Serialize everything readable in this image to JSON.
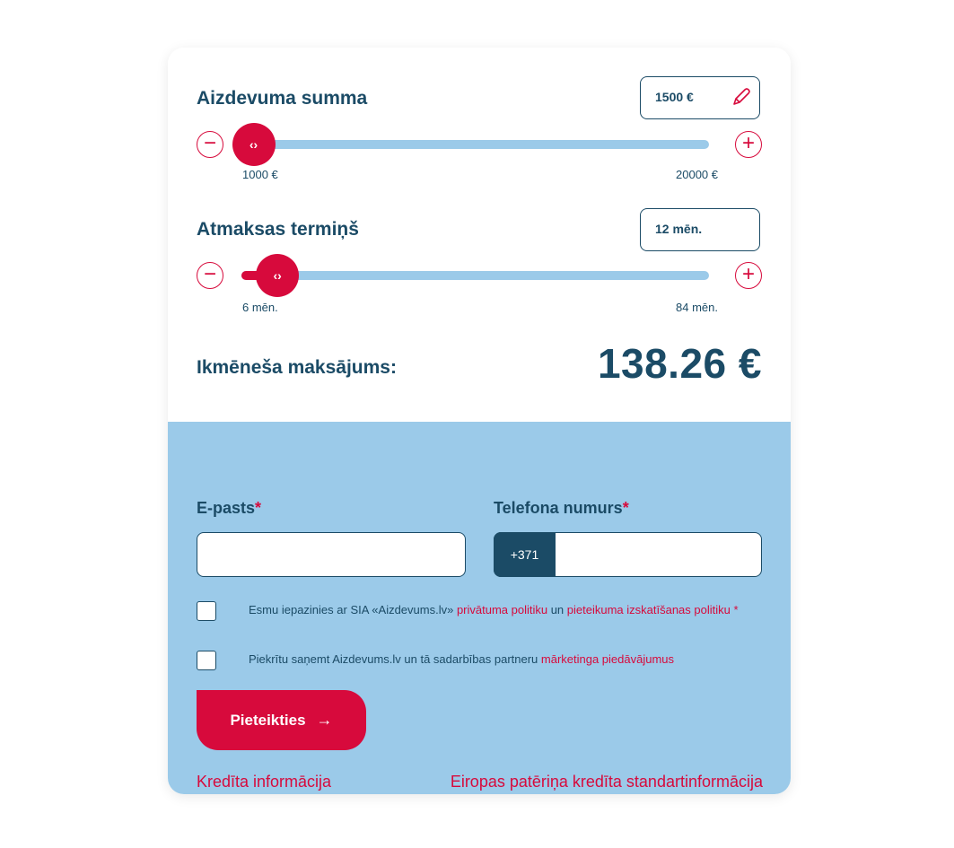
{
  "loan_amount": {
    "title": "Aizdevuma summa",
    "value": "1500 €",
    "min_label": "1000 €",
    "max_label": "20000 €",
    "position": 0.026,
    "thumb_glyph": "‹›",
    "minus_glyph": "−",
    "plus_glyph": "+"
  },
  "term": {
    "title": "Atmaksas termiņš",
    "value": "12 mēn.",
    "min_label": "6 mēn.",
    "max_label": "84 mēn.",
    "position": 0.077,
    "thumb_glyph": "‹›",
    "minus_glyph": "−",
    "plus_glyph": "+"
  },
  "payment": {
    "label": "Ikmēneša maksājums:",
    "value": "138.26 €"
  },
  "form": {
    "email_label": "E-pasts",
    "email_required": "*",
    "email_value": "",
    "phone_label": "Telefona numurs",
    "phone_required": "*",
    "phone_prefix": "+371",
    "phone_value": "",
    "consent_privacy": {
      "text_before": "Esmu iepazinies ar SIA «Aizdevums.lv» ",
      "privacy_link": "privātuma politiku",
      "text_middle": " un ",
      "review_link": "pieteikuma izskatīšanas politiku *"
    },
    "consent_marketing": {
      "text_before": "Piekrītu saņemt Aizdevums.lv un tā sadarbības partneru ",
      "marketing_link": "mārketinga piedāvājumus"
    },
    "submit_label": "Pieteikties",
    "submit_arrow": "→"
  },
  "footer": {
    "credit_info_link": "Kredīta informācija",
    "eu_info_link": "Eiropas patēriņa kredīta standartinformācija"
  },
  "colors": {
    "navy": "#1b4b66",
    "accent_red": "#d70a3c",
    "light_blue": "#9bcae9"
  },
  "icons": {
    "edit": "pencil-icon",
    "decrease": "minus-icon",
    "increase": "plus-icon",
    "thumb": "chevrons-left-right-icon",
    "submit": "arrow-right-icon"
  }
}
